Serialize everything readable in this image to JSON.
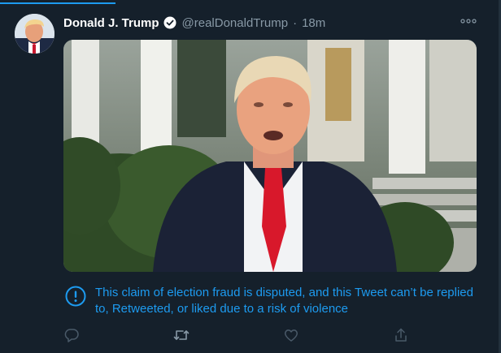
{
  "tweet": {
    "author_name": "Donald J. Trump",
    "handle": "@realDonaldTrump",
    "separator": "·",
    "time": "18m",
    "verified": true,
    "avatar_icon": "profile-photo",
    "more_icon": "more-icon",
    "notice_text": "This claim of election fraud is disputed, and this Tweet can’t be replied to, Retweeted, or liked due to a risk of violence",
    "notice_icon": "exclamation-circle-icon"
  },
  "actions": [
    {
      "name": "reply",
      "icon": "reply-icon"
    },
    {
      "name": "retweet",
      "icon": "retweet-icon"
    },
    {
      "name": "like",
      "icon": "heart-icon"
    },
    {
      "name": "share",
      "icon": "share-icon"
    }
  ],
  "colors": {
    "background": "#15202b",
    "accent": "#1d9bf0",
    "secondary_text": "#8899a6",
    "primary_text": "#ffffff"
  }
}
